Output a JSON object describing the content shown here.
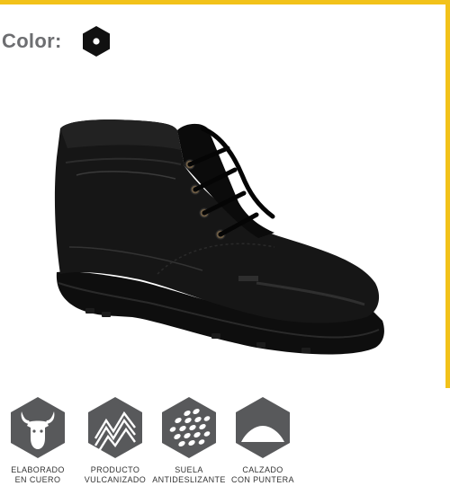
{
  "color_section": {
    "label": "Color:",
    "swatches": [
      {
        "name": "negro",
        "hex": "#111111"
      }
    ]
  },
  "product": {
    "image_alt": "Black leather lace-up ankle safety boot"
  },
  "features": [
    {
      "line1": "ELABORADO",
      "line2": "EN CUERO",
      "icon": "bull-head-icon"
    },
    {
      "line1": "PRODUCTO",
      "line2": "VULCANIZADO",
      "icon": "vulcanized-sole-icon"
    },
    {
      "line1": "SUELA",
      "line2": "ANTIDESLIZANTE",
      "icon": "anti-slip-sole-icon"
    },
    {
      "line1": "CALZADO",
      "line2": "CON PUNTERA",
      "icon": "toe-cap-icon"
    }
  ],
  "colors": {
    "accent": "#f2c21a",
    "label_gray": "#6d6e71",
    "icon_gray": "#58595b"
  }
}
